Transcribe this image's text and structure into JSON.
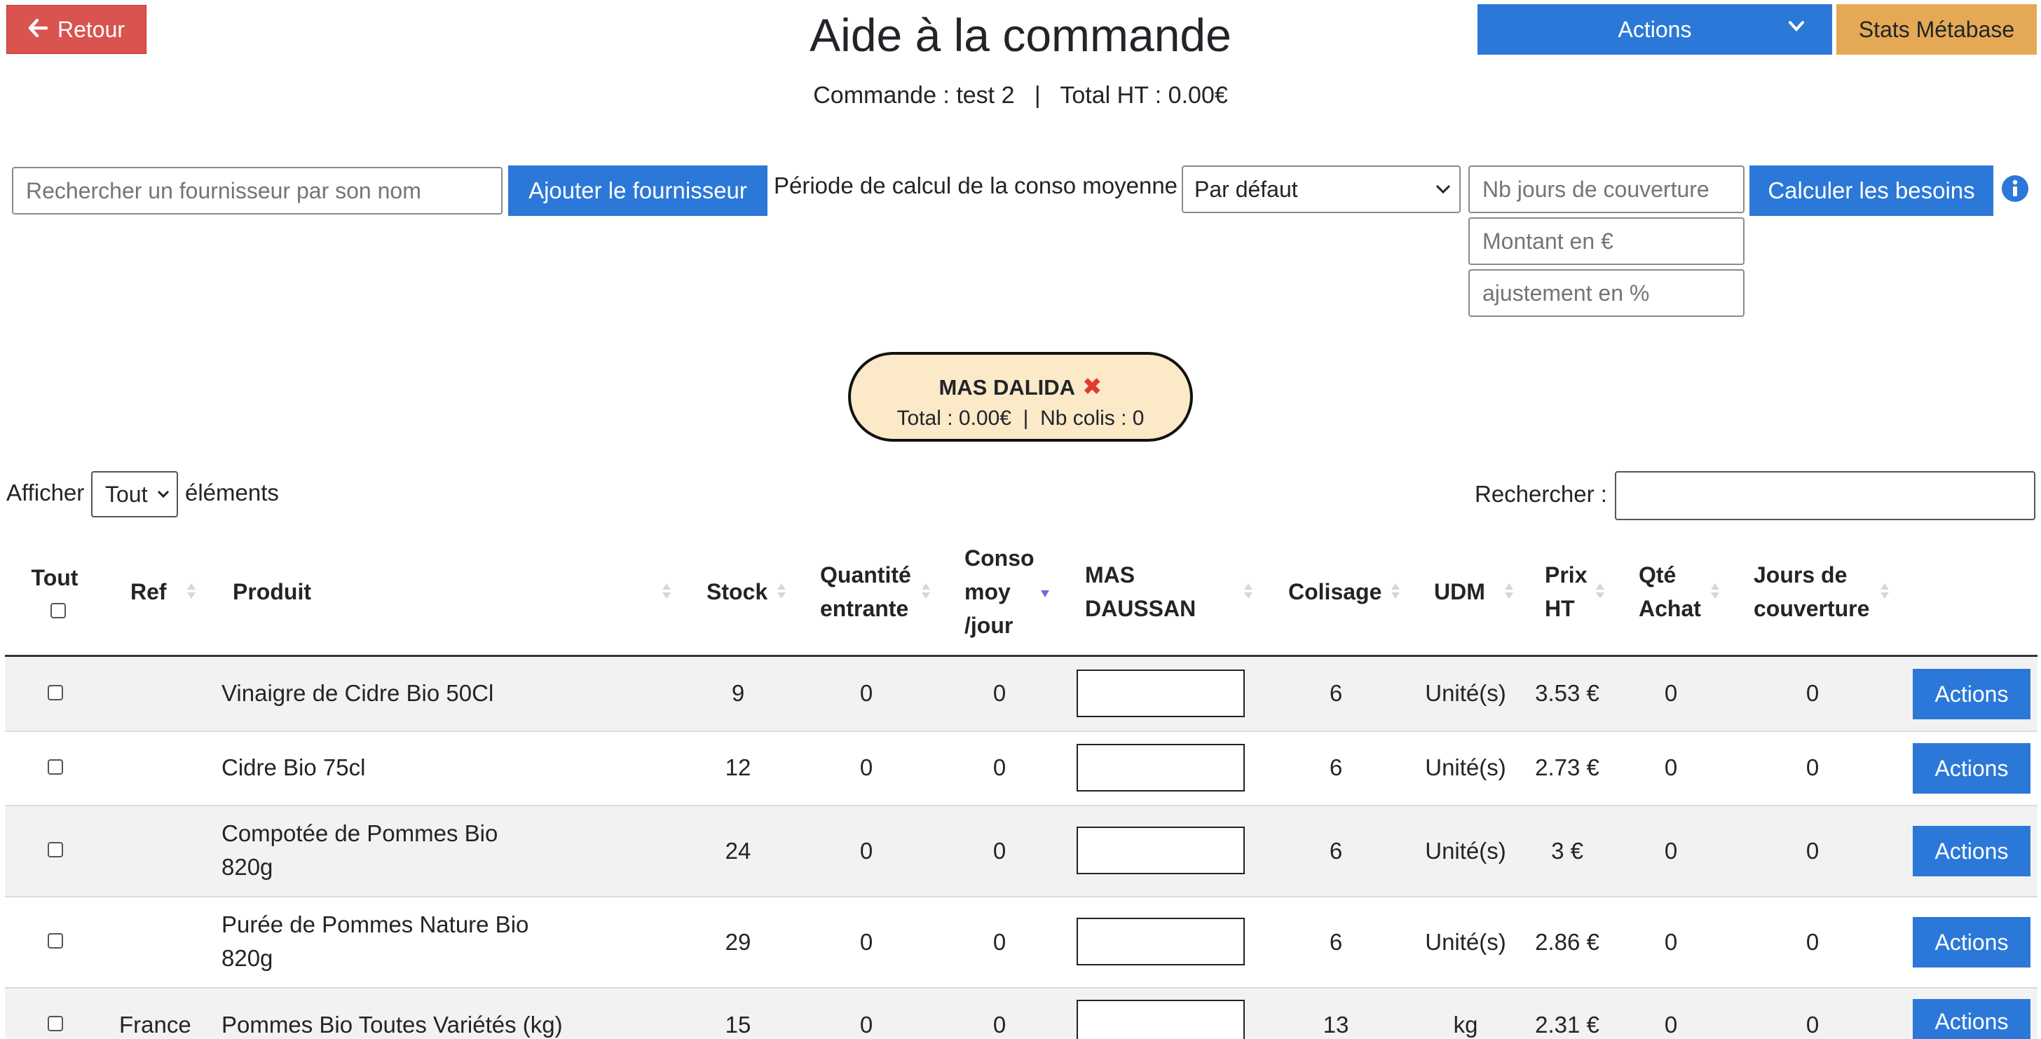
{
  "header": {
    "back_label": "Retour",
    "title": "Aide à la commande",
    "subtitle": "Commande : test 2   |   Total HT : 0.00€",
    "actions_label": "Actions",
    "stats_label": "Stats Métabase"
  },
  "filters": {
    "supplier_search_placeholder": "Rechercher un fournisseur par son nom",
    "add_supplier_label": "Ajouter le fournisseur",
    "period_label": "Période de calcul de la conso moyenne",
    "period_value": "Par défaut",
    "days_placeholder": "Nb jours de couverture",
    "amount_placeholder": "Montant en €",
    "adjust_placeholder": "ajustement en %",
    "compute_label": "Calculer les besoins"
  },
  "supplier": {
    "name": "MAS DALIDA",
    "totals": "Total : 0.00€  |  Nb colis : 0"
  },
  "table_controls": {
    "show_prefix": "Afficher",
    "show_value": "Tout",
    "show_suffix": "éléments",
    "search_label": "Rechercher :"
  },
  "columns": {
    "all": "Tout",
    "ref": "Ref",
    "product": "Produit",
    "stock": "Stock",
    "incoming_1": "Quantité",
    "incoming_2": "entrante",
    "conso_1": "Conso",
    "conso_2": "moy",
    "conso_3": "/jour",
    "supplier_1": "MAS",
    "supplier_2": "DAUSSAN",
    "packaging": "Colisage",
    "udm": "UDM",
    "price_1": "Prix",
    "price_2": "HT",
    "qty_1": "Qté",
    "qty_2": "Achat",
    "days_1": "Jours de",
    "days_2": "couverture"
  },
  "rows": [
    {
      "ref": "",
      "product_1": "Vinaigre de Cidre Bio 50Cl",
      "product_2": "",
      "stock": "9",
      "incoming": "0",
      "conso": "0",
      "packaging": "6",
      "udm": "Unité(s)",
      "price": "3.53 €",
      "qty": "0",
      "days": "0",
      "action": "Actions"
    },
    {
      "ref": "",
      "product_1": "Cidre Bio 75cl",
      "product_2": "",
      "stock": "12",
      "incoming": "0",
      "conso": "0",
      "packaging": "6",
      "udm": "Unité(s)",
      "price": "2.73 €",
      "qty": "0",
      "days": "0",
      "action": "Actions"
    },
    {
      "ref": "",
      "product_1": "Compotée de Pommes Bio",
      "product_2": "820g",
      "stock": "24",
      "incoming": "0",
      "conso": "0",
      "packaging": "6",
      "udm": "Unité(s)",
      "price": "3 €",
      "qty": "0",
      "days": "0",
      "action": "Actions"
    },
    {
      "ref": "",
      "product_1": "Purée de Pommes Nature Bio",
      "product_2": "820g",
      "stock": "29",
      "incoming": "0",
      "conso": "0",
      "packaging": "6",
      "udm": "Unité(s)",
      "price": "2.86 €",
      "qty": "0",
      "days": "0",
      "action": "Actions"
    },
    {
      "ref": "France",
      "product_1": "Pommes Bio Toutes Variétés (kg)",
      "product_2": "",
      "stock": "15",
      "incoming": "0",
      "conso": "0",
      "packaging": "13",
      "udm": "kg",
      "price": "2.31 €",
      "qty": "0",
      "days": "0",
      "action": "Actions"
    }
  ],
  "colors": {
    "primary": "#2b78d8",
    "danger": "#d9534f",
    "warning": "#e5a955",
    "pill_bg": "#fbe9c8"
  }
}
